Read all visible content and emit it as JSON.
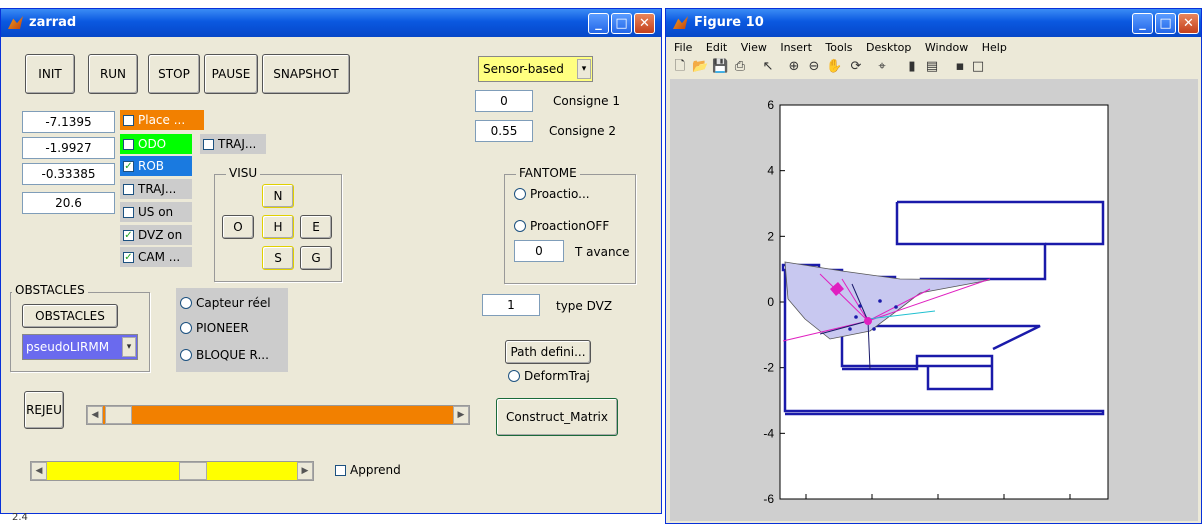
{
  "main_window": {
    "title": "zarrad"
  },
  "toolbar_buttons": {
    "init": "INIT",
    "run": "RUN",
    "stop": "STOP",
    "pause": "PAUSE",
    "snapshot": "SNAPSHOT"
  },
  "mode_select": {
    "value": "Sensor-based"
  },
  "consignes": {
    "c1_value": "0",
    "c1_label": "Consigne 1",
    "c2_value": "0.55",
    "c2_label": "Consigne 2"
  },
  "edits": [
    "-7.1395",
    "-1.9927",
    "-0.33385",
    "20.6"
  ],
  "checkboxes": {
    "place": "Place ...",
    "odo": "ODO",
    "rob": "ROB",
    "traj1": "TRAJ...",
    "traj2": "TRAJ...",
    "us": "US on",
    "dvz": "DVZ on",
    "cam": "CAM ..."
  },
  "visu": {
    "title": "VISU",
    "n": "N",
    "o": "O",
    "h": "H",
    "e": "E",
    "s": "S",
    "g": "G"
  },
  "fantome": {
    "title": "FANTOME",
    "proaction_on": "Proactio...",
    "proaction_off": "ProactionOFF",
    "t_avance_value": "0",
    "t_avance_label": "T avance"
  },
  "dvz": {
    "value": "1",
    "label": "type DVZ"
  },
  "obstacles": {
    "title": "OBSTACLES",
    "button": "OBSTACLES",
    "select": "pseudoLIRMM"
  },
  "sensors": {
    "capteur": "Capteur réel",
    "pioneer": "PIONEER",
    "bloque": "BLOQUE R..."
  },
  "path": {
    "button": "Path defini...",
    "deform": "DeformTraj"
  },
  "rejeu": "REJEU",
  "construct": "Construct_Matrix",
  "apprend": "Apprend",
  "status_bar": "2.4",
  "colors": {
    "orange": "#f28000",
    "yellow": "#ffff00",
    "odo_green": "#00ff00",
    "rob_blue": "#1a7ae0",
    "plot_blue": "#1a1aaa"
  },
  "figure": {
    "title": "Figure 10",
    "menu": [
      "File",
      "Edit",
      "View",
      "Insert",
      "Tools",
      "Desktop",
      "Window",
      "Help"
    ],
    "toolbar_icons": [
      "new-file-icon",
      "open-icon",
      "save-icon",
      "print-icon",
      "pointer-icon",
      "zoom-in-icon",
      "zoom-out-icon",
      "pan-icon",
      "rotate-icon",
      "datacursor-icon",
      "colorbar-icon",
      "legend-icon",
      "hide-plot-tools-icon",
      "show-plot-tools-icon"
    ]
  },
  "chart_data": {
    "type": "line",
    "title": "",
    "xlabel": "",
    "ylabel": "",
    "ylim": [
      -6,
      6
    ],
    "yticks": [
      "6",
      "4",
      "2",
      "0",
      "-2",
      "-4",
      "-6"
    ],
    "xticks": [
      "",
      "",
      "",
      "",
      ""
    ],
    "grid": false
  }
}
